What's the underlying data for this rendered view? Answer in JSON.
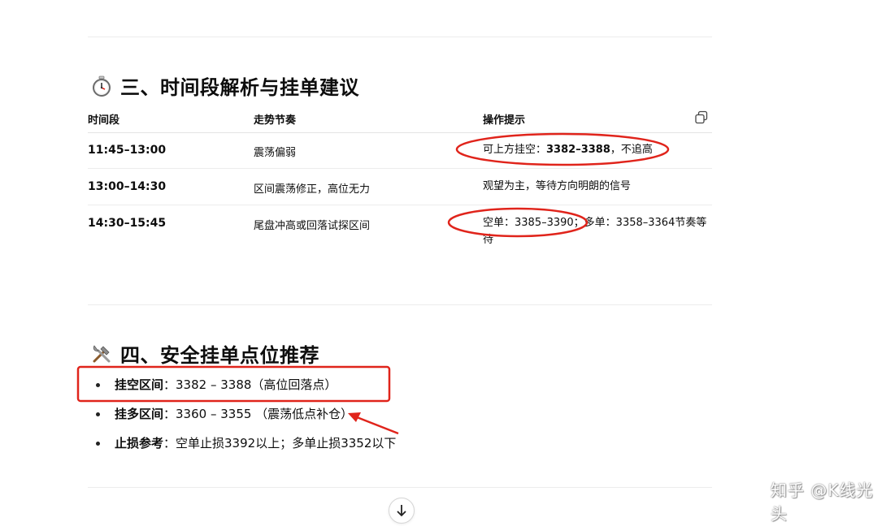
{
  "section3": {
    "title": "三、时间段解析与挂单建议",
    "icon": "stopwatch-icon",
    "table": {
      "headers": [
        "时间段",
        "走势节奏",
        "操作提示"
      ],
      "rows": [
        {
          "time": "11:45–13:00",
          "trend": "震荡偏弱",
          "tip_pre": "可上方挂空：",
          "tip_bold": "3382–3388",
          "tip_post": "，不追高"
        },
        {
          "time": "13:00–14:30",
          "trend": "区间震荡修正，高位无力",
          "tip_pre": "观望为主，等待方向明朗的信号",
          "tip_bold": "",
          "tip_post": ""
        },
        {
          "time": "14:30–15:45",
          "trend": "尾盘冲高或回落试探区间",
          "tip_pre": "空单：3385–3390；多单：3358–3364节奏等待",
          "tip_bold": "",
          "tip_post": ""
        }
      ]
    }
  },
  "section4": {
    "title": "四、安全挂单点位推荐",
    "icon": "tools-icon",
    "items": [
      {
        "label": "挂空区间",
        "text": "：3382 – 3388（高位回落点）"
      },
      {
        "label": "挂多区间",
        "text": "：3360 – 3355 （震荡低点补仓）"
      },
      {
        "label": "止损参考",
        "text": "：空单止损3392以上；多单止损3352以下"
      }
    ]
  },
  "watermark": "知乎 @K线光头",
  "colors": {
    "annotation": "#e0241b",
    "text": "#0d0d0d",
    "divider": "#ececec"
  }
}
